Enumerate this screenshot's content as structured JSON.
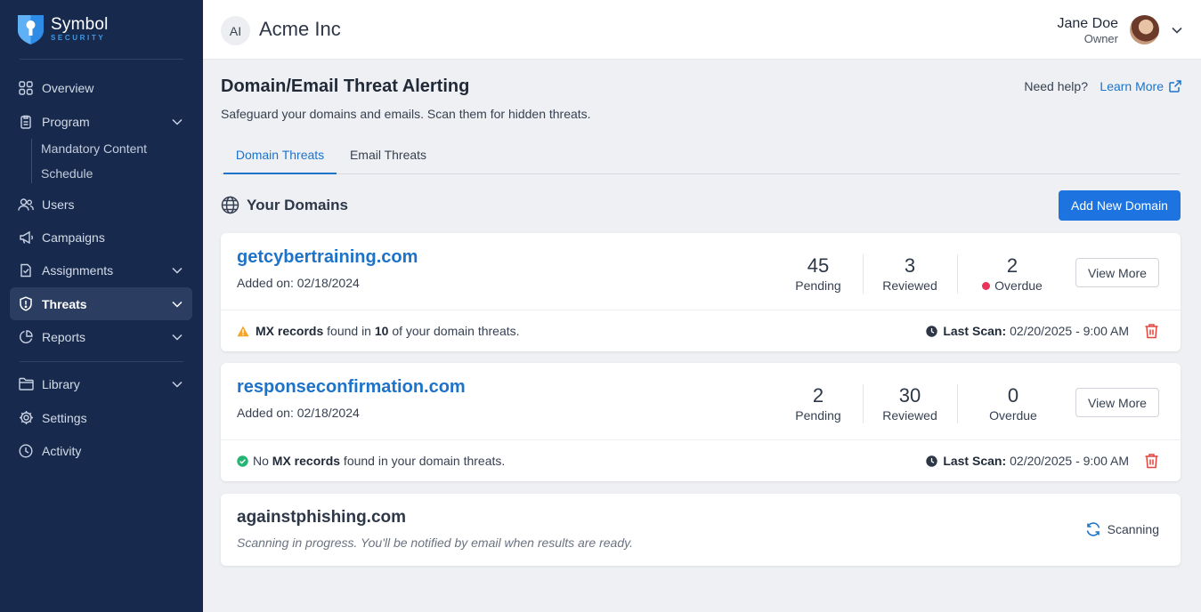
{
  "brand": {
    "name": "Symbol",
    "sub": "SECURITY"
  },
  "sidebar": {
    "items": [
      {
        "label": "Overview",
        "icon": "grid-icon"
      },
      {
        "label": "Program",
        "icon": "clipboard-icon"
      },
      {
        "label": "Users",
        "icon": "users-icon"
      },
      {
        "label": "Campaigns",
        "icon": "megaphone-icon"
      },
      {
        "label": "Assignments",
        "icon": "assignment-icon"
      },
      {
        "label": "Threats",
        "icon": "shield-icon"
      },
      {
        "label": "Reports",
        "icon": "pie-chart-icon"
      },
      {
        "label": "Library",
        "icon": "folder-icon"
      },
      {
        "label": "Settings",
        "icon": "gear-icon"
      },
      {
        "label": "Activity",
        "icon": "clock-icon"
      }
    ],
    "sub_items": [
      "Mandatory Content",
      "Schedule"
    ]
  },
  "topbar": {
    "org_initials": "AI",
    "org_name": "Acme Inc",
    "user_name": "Jane Doe",
    "user_role": "Owner"
  },
  "page": {
    "title": "Domain/Email Threat Alerting",
    "subtitle": "Safeguard your domains and emails. Scan them for hidden threats.",
    "help_text": "Need help?",
    "learn_more": "Learn More",
    "tabs": [
      "Domain Threats",
      "Email Threats"
    ],
    "section_title": "Your Domains",
    "add_button": "Add New Domain"
  },
  "domains": [
    {
      "name": "getcybertraining.com",
      "added": "Added on: 02/18/2024",
      "pending": "45",
      "pending_label": "Pending",
      "reviewed": "3",
      "reviewed_label": "Reviewed",
      "overdue": "2",
      "overdue_label": "Overdue",
      "view_more": "View More",
      "mx_prefix": "MX records",
      "mx_mid": " found in ",
      "mx_count": "10",
      "mx_suffix": " of your domain threats.",
      "last_scan_label": "Last Scan:",
      "last_scan": "02/20/2025 - 9:00 AM"
    },
    {
      "name": "responseconfirmation.com",
      "added": "Added on: 02/18/2024",
      "pending": "2",
      "pending_label": "Pending",
      "reviewed": "30",
      "reviewed_label": "Reviewed",
      "overdue": "0",
      "overdue_label": "Overdue",
      "view_more": "View More",
      "mx_pre": "No ",
      "mx_prefix": "MX records",
      "mx_suffix": " found in your domain threats.",
      "last_scan_label": "Last Scan:",
      "last_scan": "02/20/2025 - 9:00 AM"
    }
  ],
  "scanning": {
    "name": "againstphishing.com",
    "note": "Scanning in progress. You'll be notified by email when results are ready.",
    "status": "Scanning"
  },
  "colors": {
    "sidebar": "#172a4d",
    "accent": "#1d73c9",
    "button": "#1d73e0",
    "danger": "#e8335a",
    "warning": "#f5a524",
    "success": "#22b573"
  }
}
